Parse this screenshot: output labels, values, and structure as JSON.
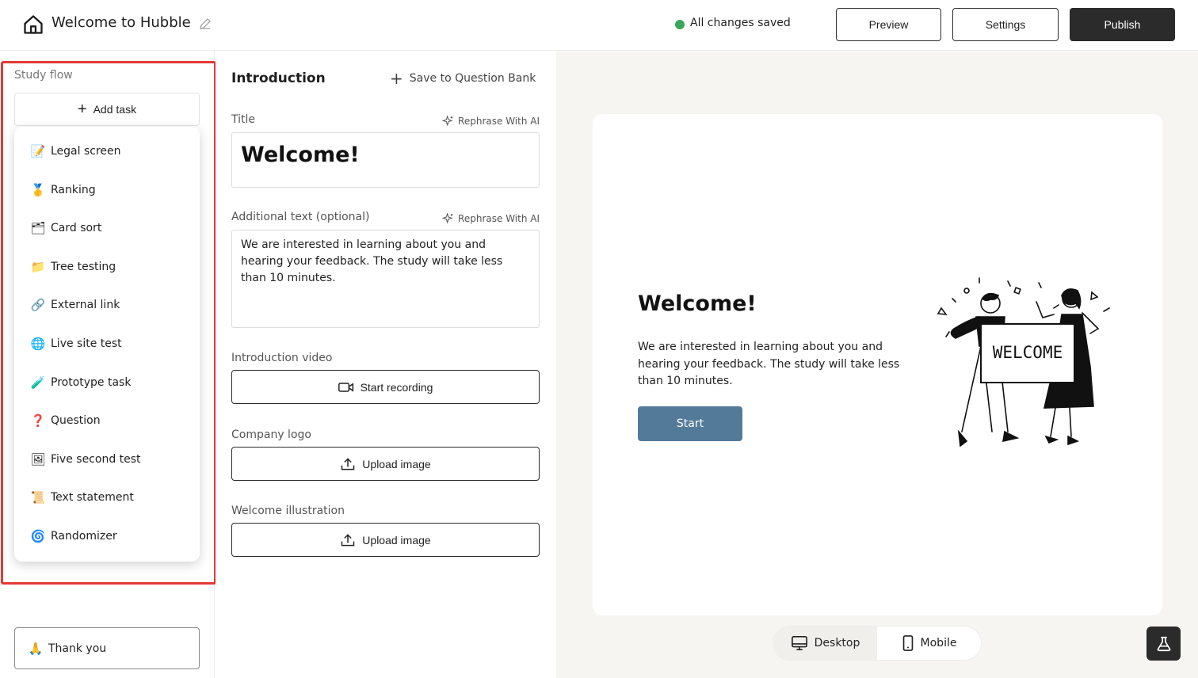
{
  "header": {
    "title": "Welcome to Hubble",
    "status": "All changes saved",
    "status_color": "#3aa55c",
    "buttons": {
      "preview": "Preview",
      "settings": "Settings",
      "publish": "Publish"
    }
  },
  "sidebar": {
    "section_label": "Study flow",
    "add_task": "Add task",
    "task_menu": [
      {
        "emoji": "📝",
        "icon": "memo-icon",
        "label": "Legal screen"
      },
      {
        "emoji": "🥇",
        "icon": "medal-icon",
        "label": "Ranking"
      },
      {
        "emoji": "🗂",
        "icon": "card-box-icon",
        "label": "Card sort"
      },
      {
        "emoji": "📁",
        "icon": "folder-icon",
        "label": "Tree testing"
      },
      {
        "emoji": "🔗",
        "icon": "link-icon",
        "label": "External link"
      },
      {
        "emoji": "🌐",
        "icon": "globe-icon",
        "label": "Live site test"
      },
      {
        "emoji": "🧪",
        "icon": "test-tube-icon",
        "label": "Prototype task"
      },
      {
        "emoji": "❓",
        "icon": "question-icon",
        "label": "Question"
      },
      {
        "emoji": "🖼",
        "icon": "framed-picture-icon",
        "label": "Five second test"
      },
      {
        "emoji": "📜",
        "icon": "scroll-icon",
        "label": "Text statement"
      },
      {
        "emoji": "🌀",
        "icon": "spiral-icon",
        "label": "Randomizer"
      }
    ],
    "thank_you": {
      "emoji": "🙏",
      "label": "Thank you"
    }
  },
  "editor": {
    "section_title": "Introduction",
    "save_to_bank": "Save to Question Bank",
    "title_label": "Title",
    "rephrase_label": "Rephrase With AI",
    "title_value": "Welcome!",
    "additional_label": "Additional text (optional)",
    "additional_value": "We are interested in learning about you and hearing your feedback. The study will take less than 10 minutes.",
    "video_label": "Introduction video",
    "start_recording": "Start recording",
    "logo_label": "Company logo",
    "upload_image": "Upload image",
    "illustration_label": "Welcome illustration"
  },
  "preview": {
    "title": "Welcome!",
    "text": "We are interested in learning about you and hearing your feedback. The study will take less than 10 minutes.",
    "start_button": "Start",
    "start_color": "#547a9a",
    "illustration_sign": "WELCOME",
    "devices": {
      "desktop": "Desktop",
      "mobile": "Mobile"
    }
  }
}
